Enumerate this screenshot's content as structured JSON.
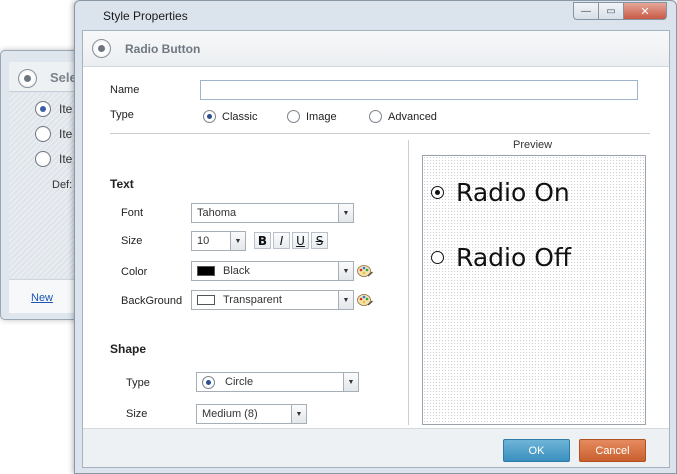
{
  "background_dialog": {
    "title": "Sele",
    "items": [
      "Ite",
      "Ite",
      "Ite"
    ],
    "default_label": "Def:",
    "new_link": "New"
  },
  "dialog": {
    "window_title": "Style Properties",
    "window_buttons": {
      "minimize": "—",
      "maximize": "▭",
      "close": "✕"
    },
    "header_title": "Radio Button",
    "name": {
      "label": "Name",
      "value": ""
    },
    "type": {
      "label": "Type",
      "options": [
        "Classic",
        "Image",
        "Advanced"
      ],
      "selected": "Classic"
    },
    "text_section": {
      "title": "Text",
      "font_label": "Font",
      "font_value": "Tahoma",
      "size_label": "Size",
      "size_value": "10",
      "format_buttons": [
        "B",
        "I",
        "U",
        "S"
      ],
      "color_label": "Color",
      "color_value": "Black",
      "color_swatch": "#000000",
      "background_label": "BackGround",
      "background_value": "Transparent",
      "background_swatch": "#ffffff"
    },
    "shape_section": {
      "title": "Shape",
      "type_label": "Type",
      "type_value": "Circle",
      "size_label": "Size",
      "size_value": "Medium (8)"
    },
    "preview": {
      "label": "Preview",
      "items": [
        "Radio On",
        "Radio Off"
      ]
    },
    "buttons": {
      "ok": "OK",
      "cancel": "Cancel"
    },
    "colors": {
      "ok": "#3a8fbf",
      "cancel": "#c9602f",
      "accent": "#3a5fa8"
    }
  }
}
